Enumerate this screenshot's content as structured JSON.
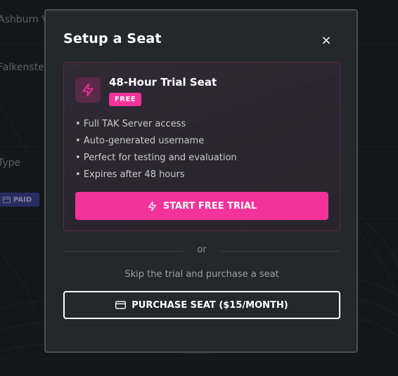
{
  "background": {
    "location_1": "Ashburn V",
    "location_2": "Falkenste",
    "column_label": "Type",
    "badge_label": "PAID"
  },
  "modal": {
    "title": "Setup a Seat",
    "close_icon": "×"
  },
  "trial": {
    "icon": "lightning-icon",
    "title": "48-Hour Trial Seat",
    "badge": "FREE",
    "features": [
      "Full TAK Server access",
      "Auto-generated username",
      "Perfect for testing and evaluation",
      "Expires after 48 hours"
    ],
    "button_label": "START FREE TRIAL"
  },
  "divider_text": "or",
  "skip_text": "Skip the trial and purchase a seat",
  "purchase": {
    "icon": "credit-card-icon",
    "button_label": "PURCHASE SEAT ($15/MONTH)"
  },
  "colors": {
    "accent": "#f3339b",
    "modal_bg": "#24282d",
    "paid_badge": "#3a3f8e"
  }
}
